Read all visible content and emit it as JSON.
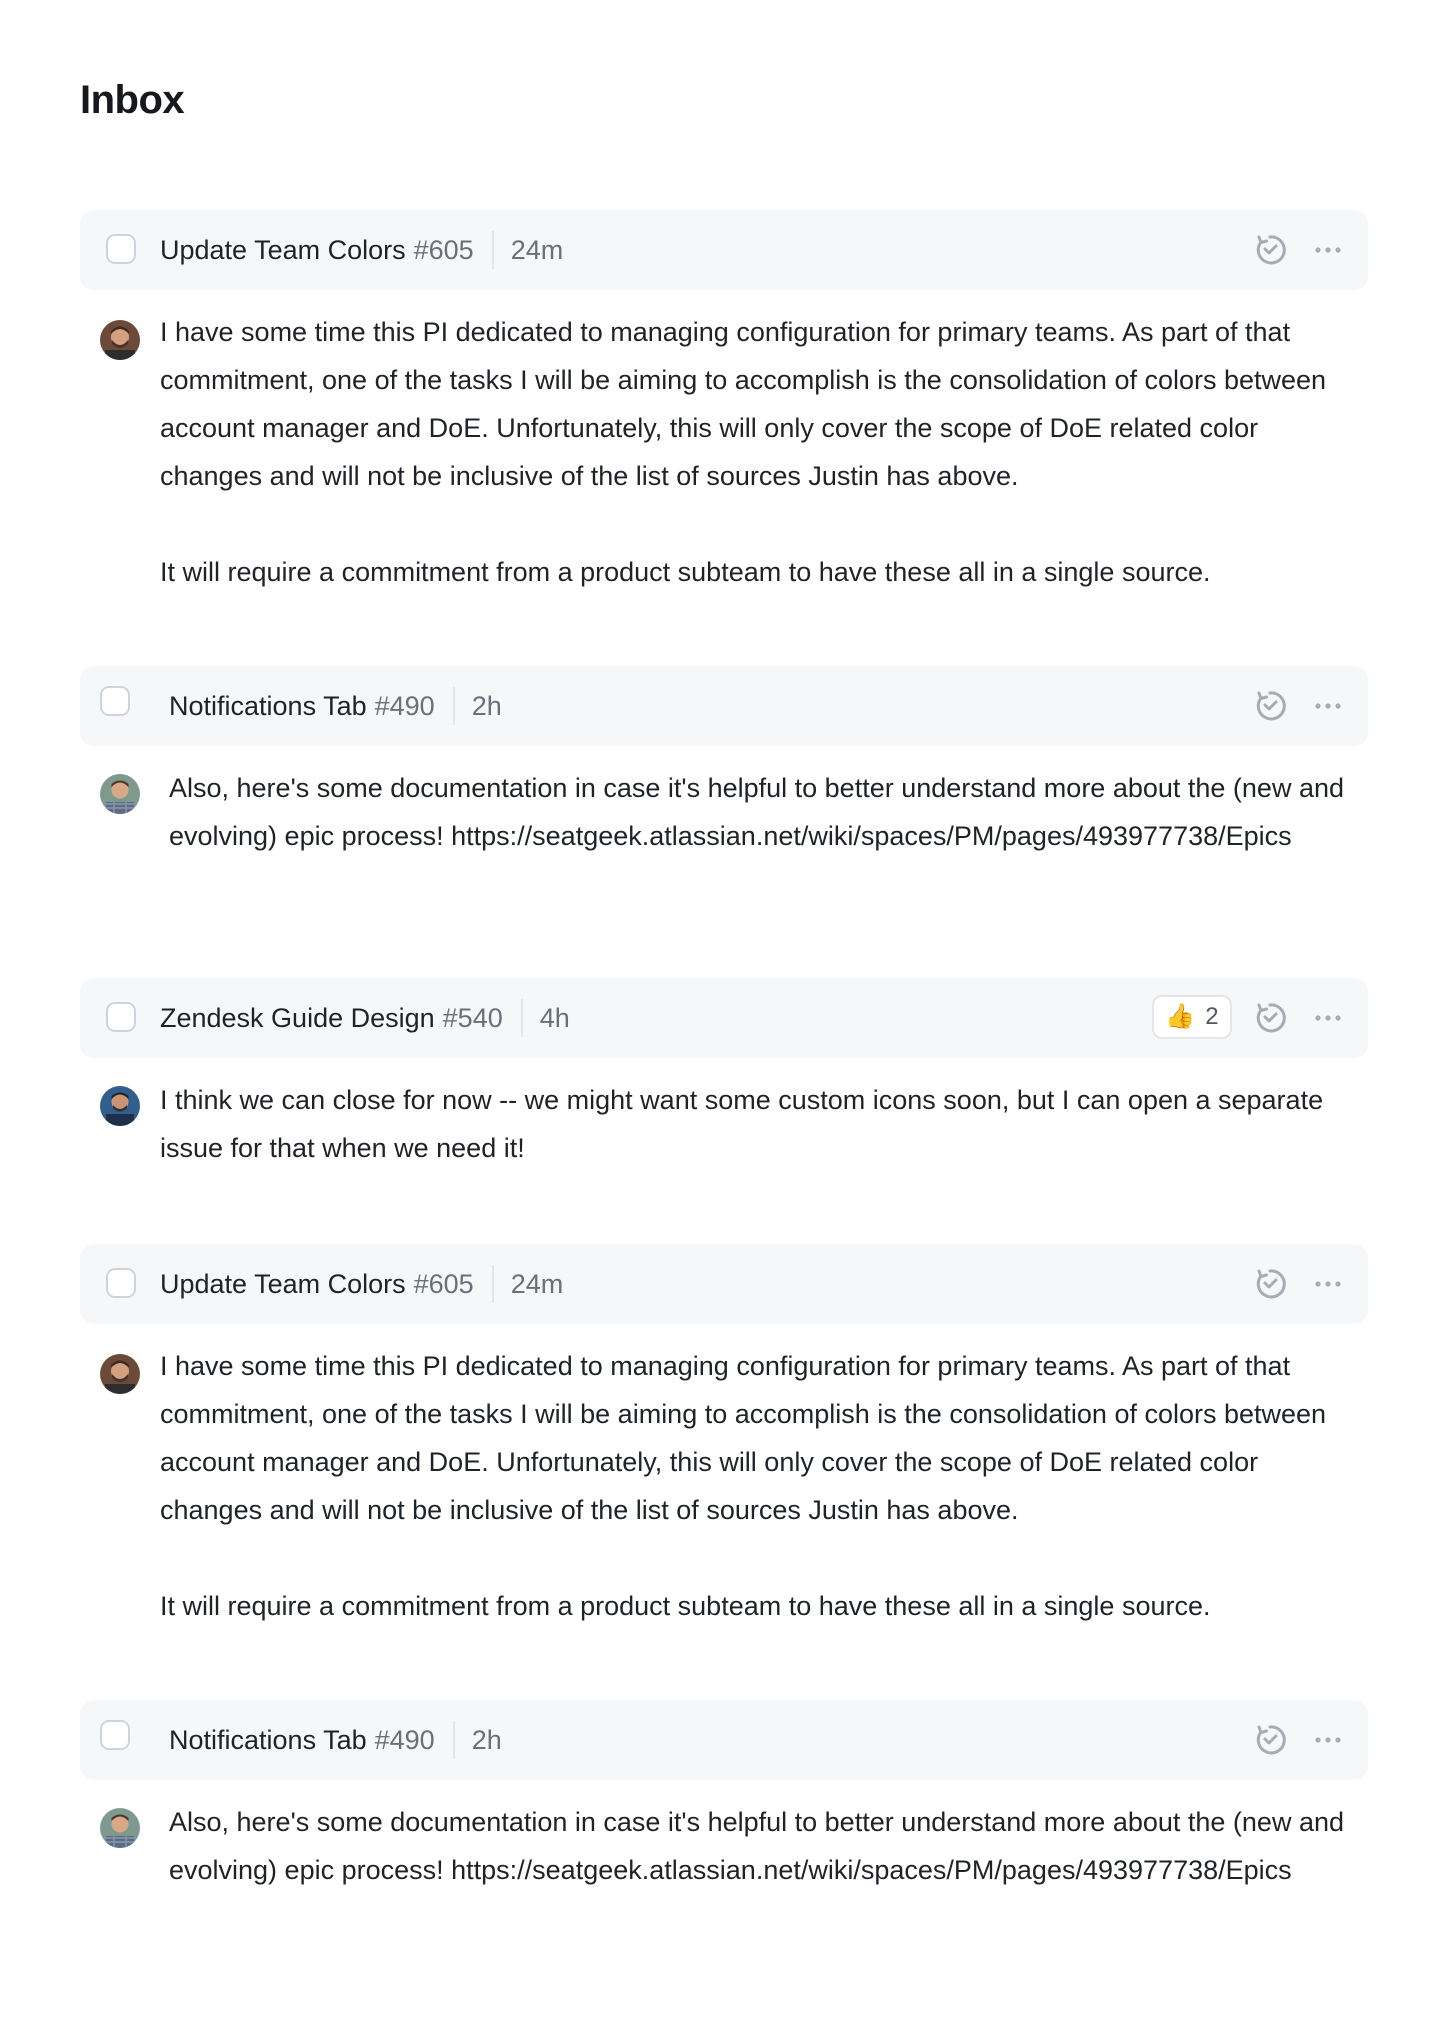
{
  "page": {
    "title": "Inbox"
  },
  "threads": [
    {
      "name": "Update Team Colors",
      "number": "#605",
      "time": "24m",
      "paragraphs": [
        "I have some time this PI dedicated to managing configuration for primary teams. As part of that commitment, one of the tasks I will be aiming to accomplish is the consolidation of colors between account manager and DoE. Unfortunately, this will only cover the scope of DoE related color changes and will not be inclusive of the list of sources Justin has above.",
        "It will require a commitment from a product subteam to have these all in a single source."
      ]
    },
    {
      "name": "Notifications Tab",
      "number": "#490",
      "time": "2h",
      "paragraphs": [
        "Also, here's some documentation in case it's helpful to better understand more about the (new and evolving) epic process! https://seatgeek.atlassian.net/wiki/spaces/PM/pages/493977738/Epics"
      ]
    },
    {
      "name": "Zendesk Guide Design",
      "number": "#540",
      "time": "4h",
      "reaction": {
        "emoji": "👍",
        "count": "2"
      },
      "paragraphs": [
        "I think we can close for now -- we might want some custom icons soon, but I can open a separate issue for that when we need it!"
      ]
    },
    {
      "name": "Update Team Colors",
      "number": "#605",
      "time": "24m",
      "paragraphs": [
        "I have some time this PI dedicated to managing configuration for primary teams. As part of that commitment, one of the tasks I will be aiming to accomplish is the consolidation of colors between account manager and DoE. Unfortunately, this will only cover the scope of DoE related color changes and will not be inclusive of the list of sources Justin has above.",
        "It will require a commitment from a product subteam to have these all in a single source."
      ]
    },
    {
      "name": "Notifications Tab",
      "number": "#490",
      "time": "2h",
      "paragraphs": [
        "Also, here's some documentation in case it's helpful to better understand more about the (new and evolving) epic process! https://seatgeek.atlassian.net/wiki/spaces/PM/pages/493977738/Epics"
      ]
    }
  ],
  "icons": {
    "snooze": "snooze-icon",
    "more": "more-horizontal-icon",
    "avatar": "user-avatar"
  },
  "colors": {
    "header_background": "#f6f7f9",
    "text_primary": "#1f2328",
    "text_secondary": "#6a7078",
    "icon_gray": "#a7acb3",
    "checkbox_border": "#d0d4da"
  }
}
